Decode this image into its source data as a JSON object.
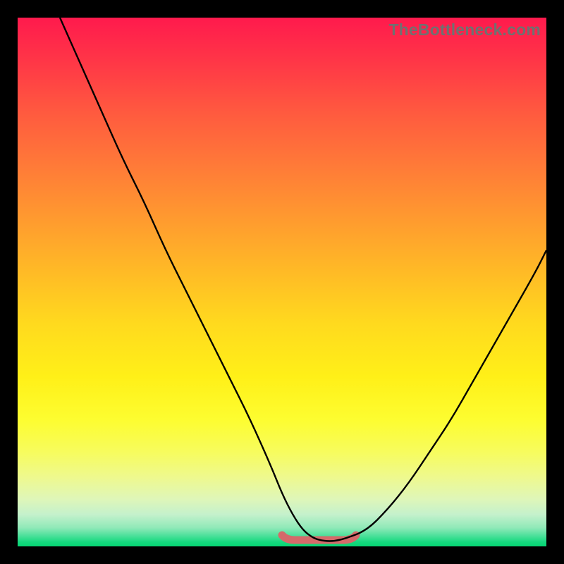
{
  "watermark": "TheBottleneck.com",
  "colors": {
    "frame": "#000000",
    "curve": "#000000",
    "min_marker": "#d56a6a"
  },
  "chart_data": {
    "type": "line",
    "title": "",
    "xlabel": "",
    "ylabel": "",
    "xlim": [
      0,
      100
    ],
    "ylim": [
      0,
      100
    ],
    "x": [
      8,
      12,
      16,
      20,
      24,
      28,
      32,
      36,
      40,
      44,
      48,
      50,
      52,
      54,
      56,
      58,
      60,
      62,
      66,
      70,
      74,
      78,
      82,
      86,
      90,
      94,
      98,
      100
    ],
    "values": [
      100,
      91,
      82,
      73,
      65,
      56,
      48,
      40,
      32,
      24,
      15,
      10,
      6,
      3,
      1.5,
      1,
      1,
      1.5,
      3,
      7,
      12,
      18,
      24,
      31,
      38,
      45,
      52,
      56
    ],
    "min_marker": {
      "x_range": [
        50,
        64
      ],
      "y": 1.2
    },
    "notes": "Axes are unlabeled in the source image; values estimated on a 0–100 normalized scale from pixel positions. Background is a vertical gradient from red (high y) through yellow to green (low y), implying lower values are better."
  }
}
